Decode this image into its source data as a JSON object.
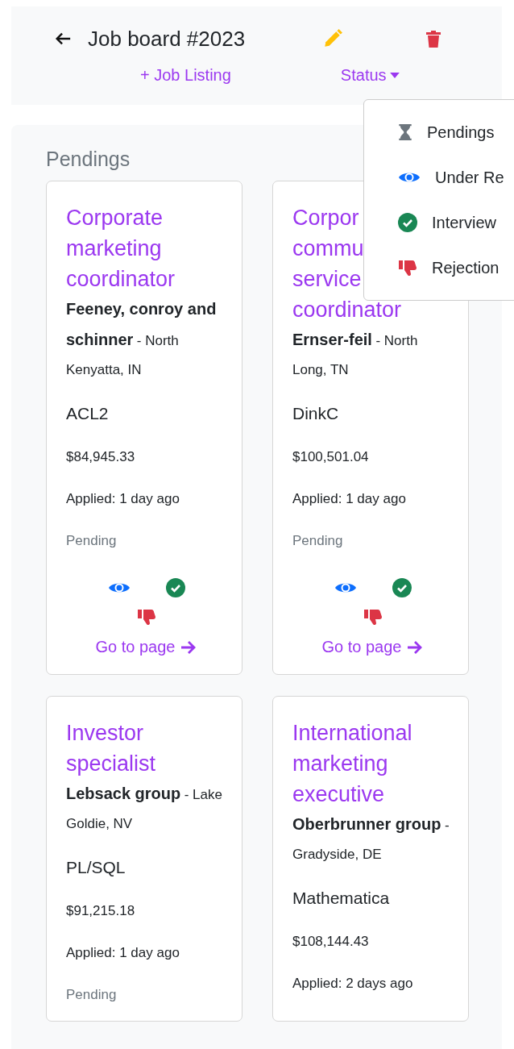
{
  "header": {
    "title": "Job board #2023",
    "add_link": "+ Job Listing",
    "status_button": "Status"
  },
  "status_menu": {
    "open": true,
    "items": [
      {
        "kind": "pending",
        "label": "Pendings"
      },
      {
        "kind": "review",
        "label": "Under Re"
      },
      {
        "kind": "interview",
        "label": "Interview"
      },
      {
        "kind": "rejection",
        "label": "Rejection"
      }
    ]
  },
  "section": {
    "title": "Pendings"
  },
  "cards": [
    {
      "title_lines": [
        "Corporate",
        "marketing",
        "coordinator"
      ],
      "company": "Feeney, conroy and schinner",
      "location": "- North Kenyatta, IN",
      "skill": "ACL2",
      "salary": "$84,945.33",
      "applied": "Applied: 1 day ago",
      "status": "Pending",
      "link": "Go to page"
    },
    {
      "title_lines": [
        "Corpor",
        "commu",
        "service",
        "coordinator"
      ],
      "company": "Ernser-feil",
      "location": "- North Long, TN",
      "skill": "DinkC",
      "salary": "$100,501.04",
      "applied": "Applied: 1 day ago",
      "status": "Pending",
      "link": "Go to page"
    },
    {
      "title_lines": [
        "Investor",
        "specialist"
      ],
      "company": "Lebsack group",
      "location": "- Lake Goldie, NV",
      "skill": "PL/SQL",
      "salary": "$91,215.18",
      "applied": "Applied: 1 day ago",
      "status": "Pending"
    },
    {
      "title_lines": [
        "International",
        "marketing",
        "executive"
      ],
      "company": "Oberbrunner group",
      "location": "- Gradyside, DE",
      "skill": "Mathematica",
      "salary": "$108,144.43",
      "applied": "Applied: 2 days ago"
    }
  ]
}
